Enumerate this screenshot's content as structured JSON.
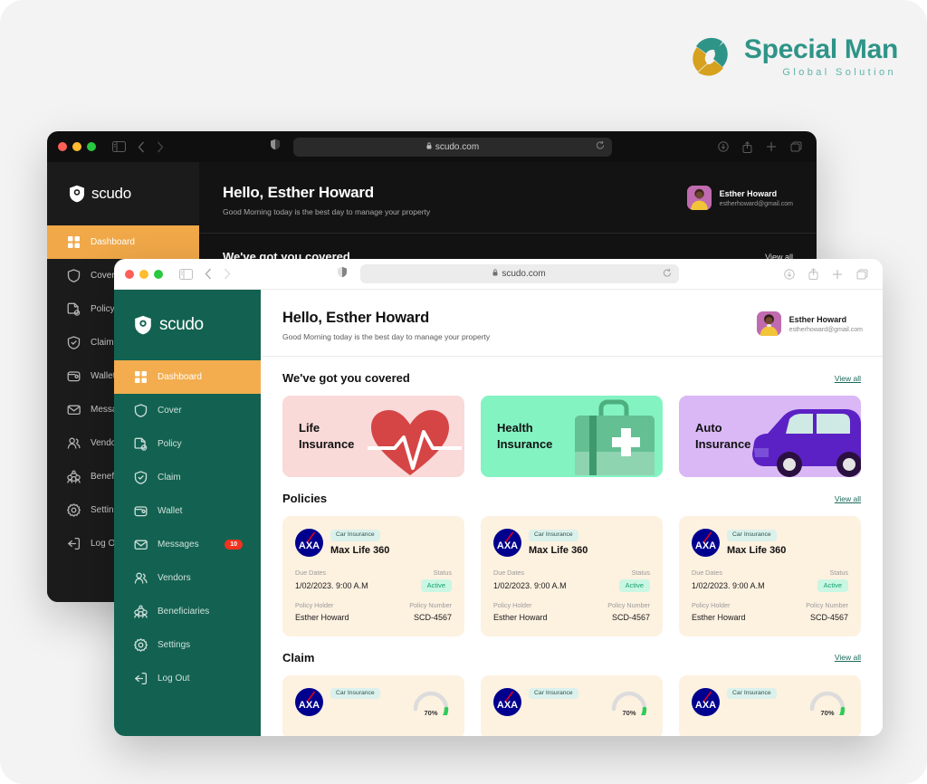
{
  "brand": {
    "name": "Special Man",
    "tagline": "Global Solution",
    "mark_teal": "#2f9488",
    "mark_gold": "#d6a11e"
  },
  "browser": {
    "url": "scudo.com",
    "lock_icon": "lock-icon",
    "reload_icon": "reload-icon",
    "sidebar_toggle_icon": "sidebar-toggle-icon",
    "back_icon": "chevron-left-icon",
    "forward_icon": "chevron-right-icon",
    "shield_icon": "privacy-shield-icon",
    "download_icon": "download-icon",
    "share_icon": "share-icon",
    "newtab_icon": "plus-icon",
    "tabs_icon": "tabs-icon"
  },
  "app": {
    "logo_text": "scudo",
    "logo_icon": "shield-logo-icon"
  },
  "sidebar": {
    "items": [
      {
        "label": "Dashboard",
        "icon": "grid-icon",
        "active": true,
        "badge": ""
      },
      {
        "label": "Cover",
        "icon": "shield-icon",
        "active": false,
        "badge": ""
      },
      {
        "label": "Policy",
        "icon": "document-check-icon",
        "active": false,
        "badge": ""
      },
      {
        "label": "Claim",
        "icon": "shield-check-icon",
        "active": false,
        "badge": ""
      },
      {
        "label": "Wallet",
        "icon": "wallet-icon",
        "active": false,
        "badge": ""
      },
      {
        "label": "Messages",
        "icon": "envelope-icon",
        "active": false,
        "badge": "10"
      },
      {
        "label": "Vendors",
        "icon": "users-icon",
        "active": false,
        "badge": ""
      },
      {
        "label": "Beneficiaries",
        "icon": "group-icon",
        "active": false,
        "badge": ""
      },
      {
        "label": "Settings",
        "icon": "gear-icon",
        "active": false,
        "badge": ""
      },
      {
        "label": "Log Out",
        "icon": "logout-icon",
        "active": false,
        "badge": ""
      }
    ],
    "active_color": "#f3ad4e",
    "bg_color": "#136251",
    "bg_color_dark": "#1b1b1b",
    "badge_color": "#f0321f"
  },
  "header": {
    "greeting": "Hello, Esther Howard",
    "subtitle": "Good Morning today is the best day to manage your property",
    "user": {
      "name": "Esther Howard",
      "email": "estherhoward@gmail.com",
      "avatar_icon": "avatar"
    }
  },
  "cover": {
    "section_title": "We've got you covered",
    "view_all": "View all",
    "cards": [
      {
        "title_line1": "Life",
        "title_line2": "Insurance",
        "bg": "#fad9d9",
        "art": "heart-pulse-art",
        "art_color": "#d64545"
      },
      {
        "title_line1": "Health",
        "title_line2": "Insurance",
        "bg": "#83f3c2",
        "art": "medical-kit-art",
        "art_color": "#4caf7d"
      },
      {
        "title_line1": "Auto",
        "title_line2": "Insurance",
        "bg": "#d9b8f5",
        "art": "car-art",
        "art_color": "#5b21c4"
      }
    ]
  },
  "policies": {
    "section_title": "Policies",
    "view_all": "View all",
    "labels": {
      "due_dates": "Due Dates",
      "status": "Status",
      "policy_holder": "Policy Holder",
      "policy_number": "Policy Number"
    },
    "cards": [
      {
        "insurer_logo": "axa-logo",
        "category": "Car Insurance",
        "name": "Max Life 360",
        "due_date": "1/02/2023. 9:00 A.M",
        "status": "Active",
        "holder": "Esther Howard",
        "number": "SCD-4567"
      },
      {
        "insurer_logo": "axa-logo",
        "category": "Car Insurance",
        "name": "Max Life 360",
        "due_date": "1/02/2023. 9:00 A.M",
        "status": "Active",
        "holder": "Esther Howard",
        "number": "SCD-4567"
      },
      {
        "insurer_logo": "axa-logo",
        "category": "Car Insurance",
        "name": "Max Life 360",
        "due_date": "1/02/2023. 9:00 A.M",
        "status": "Active",
        "holder": "Esther Howard",
        "number": "SCD-4567"
      }
    ]
  },
  "claims": {
    "section_title": "Claim",
    "view_all": "View all",
    "cards": [
      {
        "insurer_logo": "axa-logo",
        "category": "Car Insurance",
        "progress": "70%",
        "progress_value": 70
      },
      {
        "insurer_logo": "axa-logo",
        "category": "Car Insurance",
        "progress": "70%",
        "progress_value": 70
      },
      {
        "insurer_logo": "axa-logo",
        "category": "Car Insurance",
        "progress": "70%",
        "progress_value": 70
      }
    ]
  },
  "back_window": {
    "greeting": "Hello, Esther Howard",
    "subtitle": "Good Morning today is the best day to manage your property",
    "section_title": "We've got you covered",
    "view_all": "View all",
    "user": {
      "name": "Esther Howard",
      "email": "estherhoward@gmail.com"
    }
  }
}
